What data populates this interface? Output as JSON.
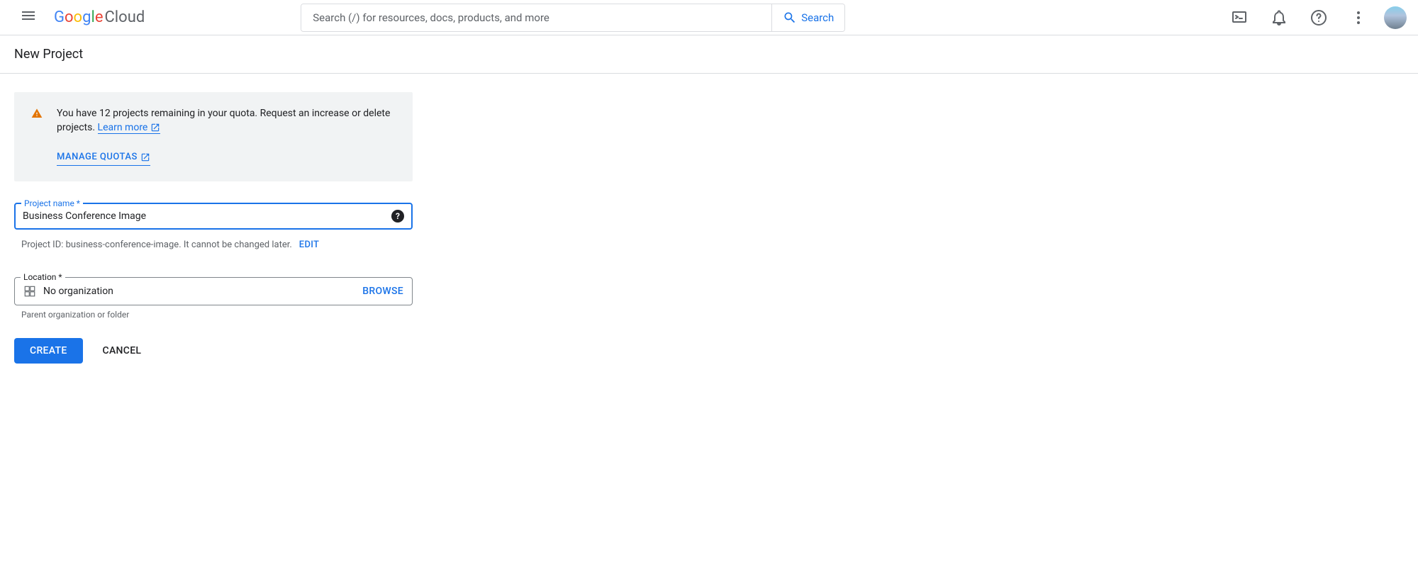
{
  "header": {
    "logo_text": "Google Cloud",
    "search_placeholder": "Search (/) for resources, docs, products, and more",
    "search_button": "Search"
  },
  "page": {
    "title": "New Project"
  },
  "quota_notice": {
    "text_part1": "You have 12 projects remaining in your quota. Request an increase or delete projects. ",
    "learn_more": "Learn more",
    "manage_quotas": "MANAGE QUOTAS"
  },
  "project_name": {
    "label": "Project name *",
    "value": "Business Conference Image"
  },
  "project_id": {
    "prefix": "Project ID: ",
    "value": "business-conference-image",
    "suffix": ". It cannot be changed later.",
    "edit": "EDIT"
  },
  "location": {
    "label": "Location *",
    "value": "No organization",
    "browse": "BROWSE",
    "helper": "Parent organization or folder"
  },
  "buttons": {
    "create": "CREATE",
    "cancel": "CANCEL"
  }
}
